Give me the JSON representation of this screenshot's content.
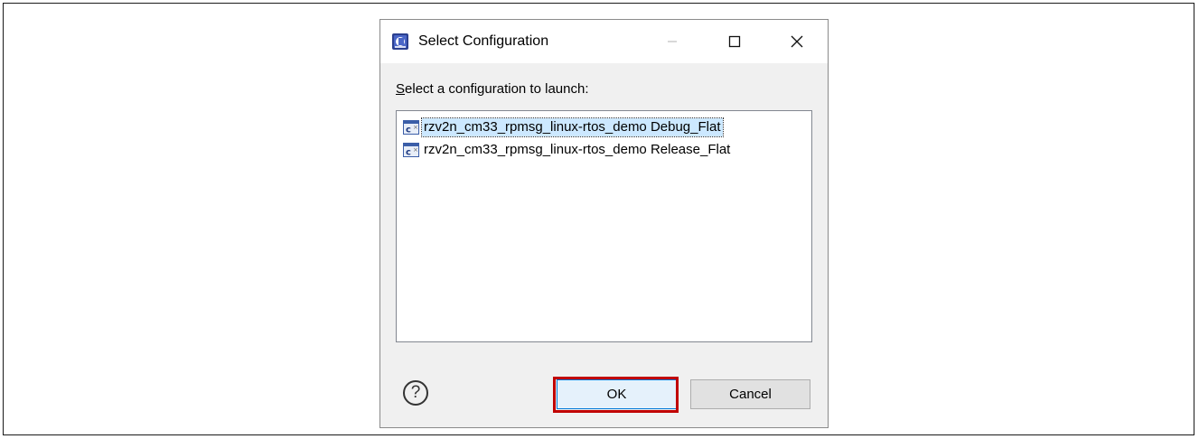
{
  "dialog": {
    "title": "Select Configuration",
    "prompt_accel": "S",
    "prompt_rest": "elect a configuration to launch:",
    "help_glyph": "?"
  },
  "window_controls": {
    "minimize_icon": "minimize-icon",
    "maximize_icon": "maximize-icon",
    "close_icon": "close-icon"
  },
  "configurations": [
    {
      "label": "rzv2n_cm33_rpmsg_linux-rtos_demo Debug_Flat",
      "icon": "c-launch-config-icon",
      "selected": true
    },
    {
      "label": "rzv2n_cm33_rpmsg_linux-rtos_demo Release_Flat",
      "icon": "c-launch-config-icon",
      "selected": false
    }
  ],
  "buttons": {
    "ok_label": "OK",
    "cancel_label": "Cancel"
  },
  "colors": {
    "highlight_border": "#c00000",
    "selection_bg": "#cce8ff",
    "dialog_bg": "#f0f0f0"
  }
}
